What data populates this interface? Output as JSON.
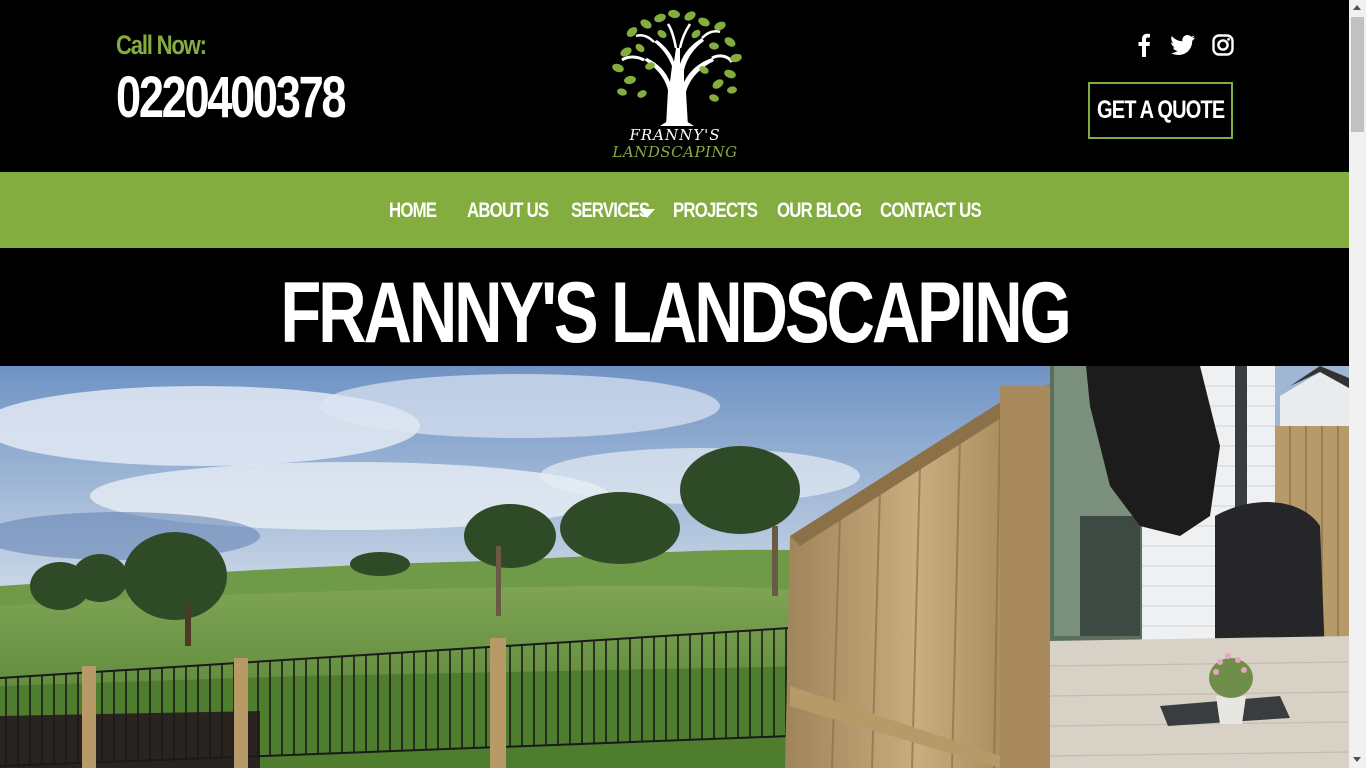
{
  "header": {
    "call_label": "Call Now:",
    "phone": "0220400378",
    "quote_button": "GET A QUOTE",
    "social": [
      "facebook-icon",
      "twitter-icon",
      "instagram-icon"
    ]
  },
  "logo": {
    "line1": "FRANNY'S",
    "line2": "LANDSCAPING"
  },
  "nav": {
    "items": [
      {
        "label": "HOME"
      },
      {
        "label": "ABOUT US"
      },
      {
        "label": "SERVICES"
      },
      {
        "label": "PROJECTS"
      },
      {
        "label": "OUR BLOG"
      },
      {
        "label": "CONTACT US"
      }
    ]
  },
  "hero": {
    "title": "FRANNY'S LANDSCAPING"
  },
  "colors": {
    "brand_green": "#84ad3f",
    "background": "#000000",
    "text": "#ffffff"
  }
}
